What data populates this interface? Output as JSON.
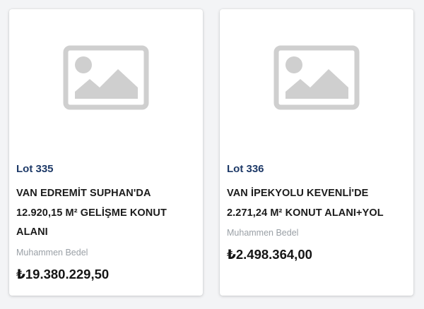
{
  "cards": [
    {
      "lot": "Lot 335",
      "title": "VAN EDREMİT SUPHAN'DA 12.920,15 M² GELİŞME KONUT ALANI",
      "price_label": "Muhammen Bedel",
      "price": "₺19.380.229,50",
      "image_icon": "image-placeholder-icon"
    },
    {
      "lot": "Lot 336",
      "title": "VAN İPEKYOLU KEVENLİ'DE 2.271,24 M² KONUT ALANI+YOL",
      "price_label": "Muhammen Bedel",
      "price": "₺2.498.364,00",
      "image_icon": "image-placeholder-icon"
    }
  ],
  "colors": {
    "lot_text": "#1e3a68",
    "placeholder_gray": "#cfcfcf",
    "label_gray": "#9aa0a6"
  }
}
